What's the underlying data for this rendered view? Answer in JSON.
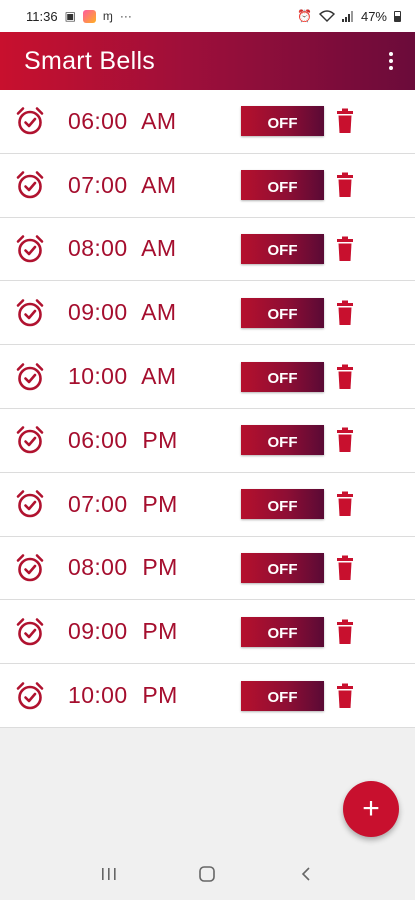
{
  "status_bar": {
    "time": "11:36",
    "dots": "···",
    "battery": "47%"
  },
  "app_bar": {
    "title": "Smart Bells"
  },
  "alarms": [
    {
      "hour": "06:00",
      "period": "AM",
      "state": "OFF"
    },
    {
      "hour": "07:00",
      "period": "AM",
      "state": "OFF"
    },
    {
      "hour": "08:00",
      "period": "AM",
      "state": "OFF"
    },
    {
      "hour": "09:00",
      "period": "AM",
      "state": "OFF"
    },
    {
      "hour": "10:00",
      "period": "AM",
      "state": "OFF"
    },
    {
      "hour": "06:00",
      "period": "PM",
      "state": "OFF"
    },
    {
      "hour": "07:00",
      "period": "PM",
      "state": "OFF"
    },
    {
      "hour": "08:00",
      "period": "PM",
      "state": "OFF"
    },
    {
      "hour": "09:00",
      "period": "PM",
      "state": "OFF"
    },
    {
      "hour": "10:00",
      "period": "PM",
      "state": "OFF"
    }
  ],
  "fab": {
    "label": "+"
  },
  "colors": {
    "brand": "#c8102e",
    "brand_dark": "#6b0b3a",
    "time_text": "#a50e2e"
  },
  "icons": {
    "row": "alarm-clock-check-icon",
    "delete": "trash-icon",
    "menu": "more-vertical-icon"
  }
}
